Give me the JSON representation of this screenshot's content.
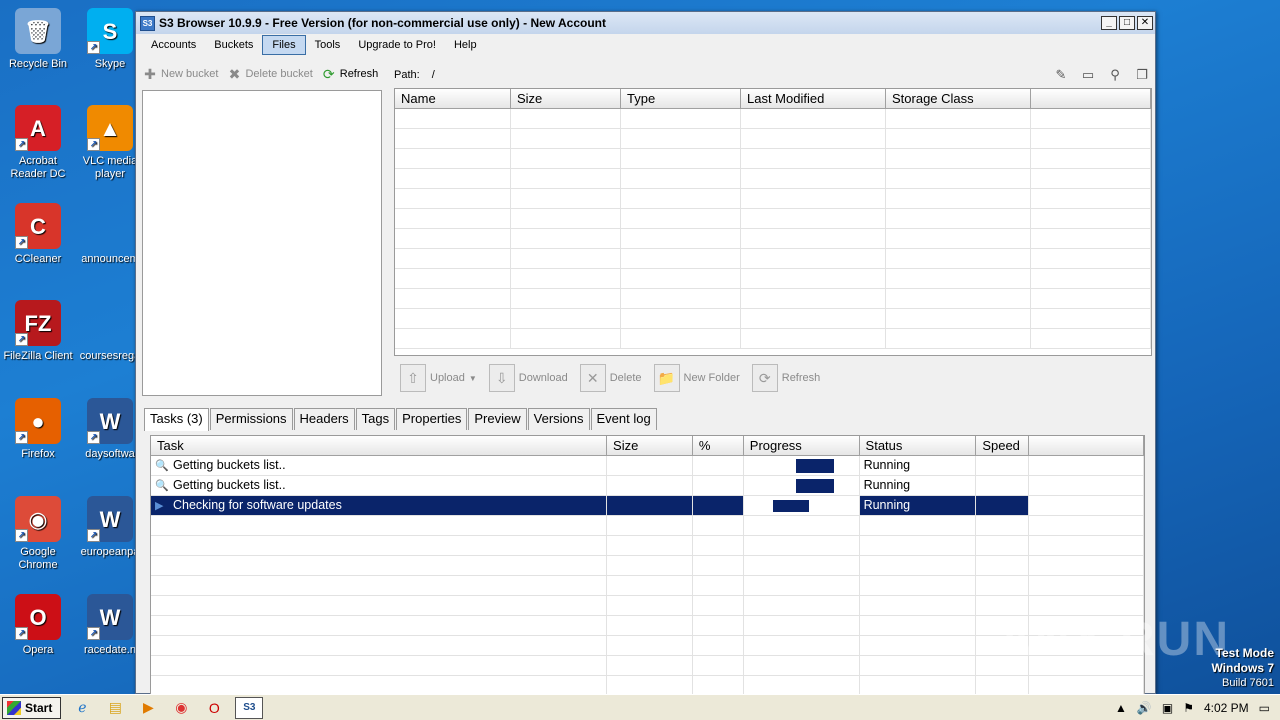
{
  "desktop": {
    "icons": [
      {
        "label": "Recycle Bin",
        "name": "recycle-bin-icon",
        "color": "#7aa6d6",
        "glyph": "🗑"
      },
      {
        "label": "Skype",
        "name": "skype-icon",
        "color": "#00aff0",
        "glyph": "S"
      },
      {
        "label": "Acrobat Reader DC",
        "name": "acrobat-reader-icon",
        "color": "#d61f26",
        "glyph": "A"
      },
      {
        "label": "VLC media player",
        "name": "vlc-icon",
        "color": "#f08a00",
        "glyph": "▲"
      },
      {
        "label": "CCleaner",
        "name": "ccleaner-icon",
        "color": "#d8352a",
        "glyph": "C"
      },
      {
        "label": "announcem",
        "name": "file-icon",
        "color": "transparent",
        "glyph": ""
      },
      {
        "label": "FileZilla Client",
        "name": "filezilla-icon",
        "color": "#b7191d",
        "glyph": "FZ"
      },
      {
        "label": "coursesrega",
        "name": "file-icon",
        "color": "transparent",
        "glyph": ""
      },
      {
        "label": "Firefox",
        "name": "firefox-icon",
        "color": "#e66000",
        "glyph": "●"
      },
      {
        "label": "daysoftwa",
        "name": "word-doc-icon",
        "color": "#2b5797",
        "glyph": "W"
      },
      {
        "label": "Google Chrome",
        "name": "chrome-icon",
        "color": "#dd4b39",
        "glyph": "◉"
      },
      {
        "label": "europeanpa",
        "name": "word-doc-icon",
        "color": "#2b5797",
        "glyph": "W"
      },
      {
        "label": "Opera",
        "name": "opera-icon",
        "color": "#cc0f16",
        "glyph": "O"
      },
      {
        "label": "racedate.n",
        "name": "word-doc-icon",
        "color": "#2b5797",
        "glyph": "W"
      }
    ]
  },
  "window": {
    "title": "S3 Browser 10.9.9 - Free Version (for non-commercial use only) - New Account",
    "app_icon": "S3",
    "menu": [
      "Accounts",
      "Buckets",
      "Files",
      "Tools",
      "Upgrade to Pro!",
      "Help"
    ],
    "active_menu": "Files"
  },
  "left_toolbar": {
    "new_bucket": "New bucket",
    "delete_bucket": "Delete bucket",
    "refresh": "Refresh"
  },
  "path": {
    "label": "Path:",
    "value": "/"
  },
  "files_table": {
    "columns": [
      "Name",
      "Size",
      "Type",
      "Last Modified",
      "Storage Class",
      ""
    ],
    "rows": []
  },
  "file_toolbar": {
    "upload": "Upload",
    "download": "Download",
    "delete": "Delete",
    "new_folder": "New Folder",
    "refresh": "Refresh"
  },
  "tabs": [
    "Tasks (3)",
    "Permissions",
    "Headers",
    "Tags",
    "Properties",
    "Preview",
    "Versions",
    "Event log"
  ],
  "tasks_table": {
    "columns": [
      "Task",
      "Size",
      "%",
      "Progress",
      "Status",
      "Speed",
      ""
    ],
    "rows": [
      {
        "task": "Getting buckets list..",
        "size": "",
        "percent": "",
        "status": "Running",
        "speed": "",
        "icon": "magnifier-icon"
      },
      {
        "task": "Getting buckets list..",
        "size": "",
        "percent": "",
        "status": "Running",
        "speed": "",
        "icon": "magnifier-icon"
      },
      {
        "task": "Checking for software updates",
        "size": "",
        "percent": "",
        "status": "Running",
        "speed": "",
        "icon": "play-icon",
        "selected": true
      }
    ]
  },
  "watermark": "ANY RUN",
  "os": {
    "test_mode": "Test Mode",
    "windows": "Windows 7",
    "build": "Build 7601",
    "start": "Start",
    "time": "4:02 PM"
  }
}
